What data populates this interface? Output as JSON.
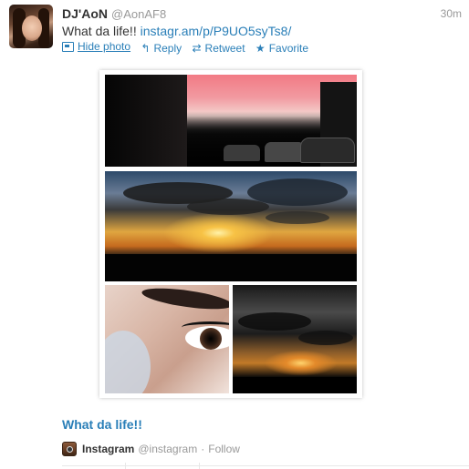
{
  "tweet": {
    "author_name": "DJ'AoN",
    "author_handle": "@AonAF8",
    "time": "30m",
    "text": "What da life!!",
    "link": "instagr.am/p/P9UO5syTs8/"
  },
  "actions": {
    "hide_photo": "Hide photo",
    "reply": "Reply",
    "retweet": "Retweet",
    "favorite": "Favorite"
  },
  "icons": {
    "photo": "photo-icon",
    "reply": "reply-arrow-icon",
    "retweet": "retweet-icon",
    "favorite": "star-icon",
    "instagram": "instagram-icon"
  },
  "card": {
    "caption": "What da life!!",
    "source_name": "Instagram",
    "source_handle": "@instagram",
    "separator": "·",
    "follow": "Follow"
  },
  "colors": {
    "link": "#2a7fb8",
    "muted": "#999999",
    "text": "#333333"
  }
}
